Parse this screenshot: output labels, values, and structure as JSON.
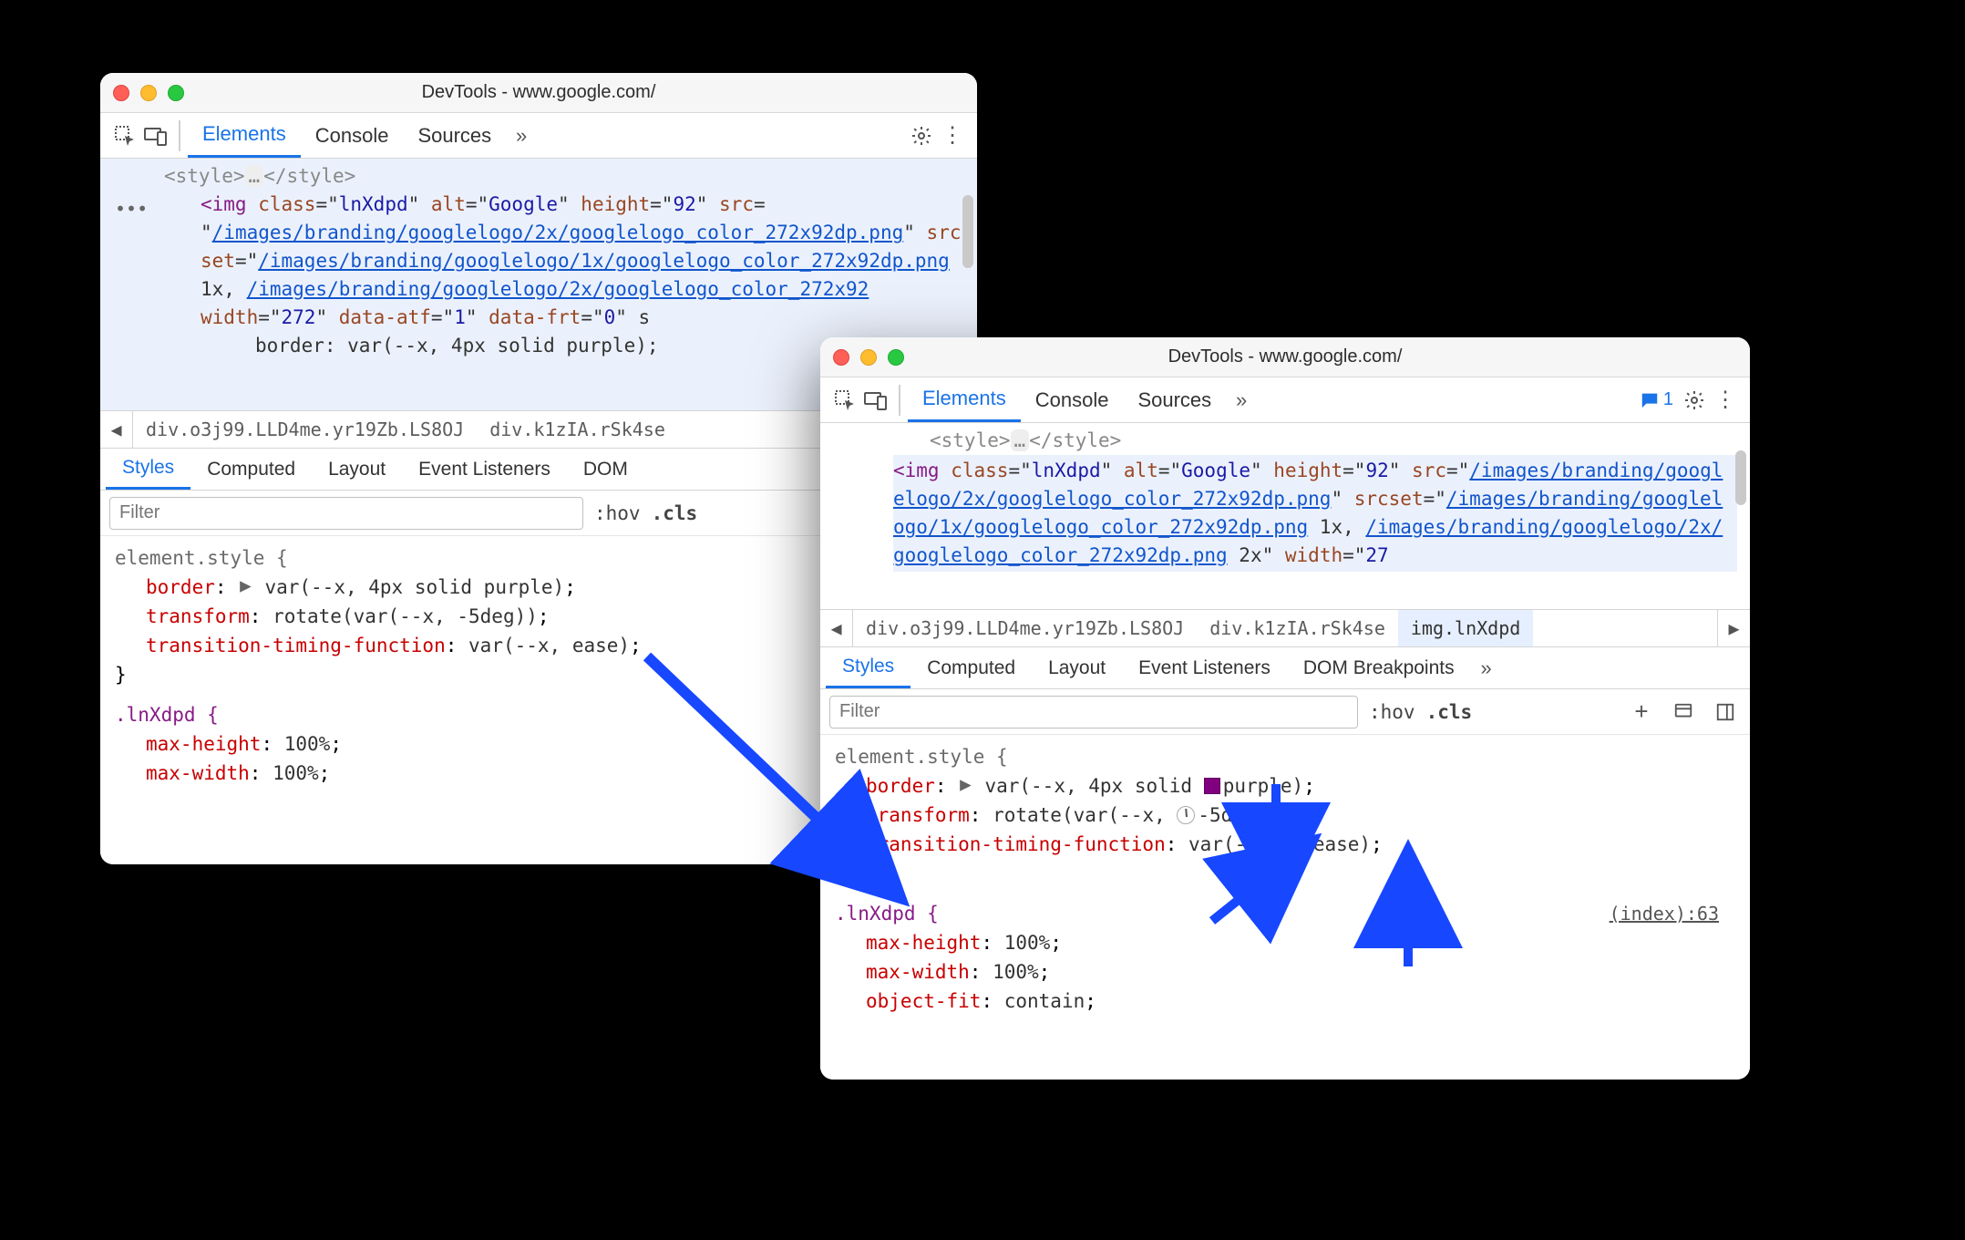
{
  "windows": {
    "left": {
      "title": "DevTools - www.google.com/",
      "tabs": {
        "elements": "Elements",
        "console": "Console",
        "sources": "Sources"
      },
      "dom": {
        "line0": "<style>…</style>",
        "img_open": "<img",
        "class_attr": "class",
        "class_val": "lnXdpd",
        "alt_attr": "alt",
        "alt_val": "Google",
        "height_attr": "height",
        "height_val": "92",
        "src_attr": "src",
        "src_val": "/images/branding/googlelogo/2x/googlelogo_color_272x92dp.png",
        "srcset_attr": "srcset",
        "srcset_val1": "/images/branding/googlelogo/1x/googlelogo_color_272x92dp.png",
        "srcset_1x": " 1x, ",
        "srcset_val2": "/images/branding/googlelogo/2x/googlelogo_color_272x92",
        "width_attr": "width",
        "width_val": "272",
        "data_atf_attr": "data-atf",
        "data_atf_val": "1",
        "data_frt_attr": "data-frt",
        "data_frt_val": "0",
        "inline_style_label": "border: var(--x, 4px solid purple);"
      },
      "crumbs": {
        "a": "div.o3j99.LLD4me.yr19Zb.LS8OJ",
        "b": "div.k1zIA.rSk4se"
      },
      "subtabs": {
        "styles": "Styles",
        "computed": "Computed",
        "layout": "Layout",
        "events": "Event Listeners",
        "dom": "DOM "
      },
      "filter": {
        "placeholder": "Filter",
        "hov": ":hov",
        "cls": ".cls"
      },
      "styles": {
        "selector0": "element.style {",
        "rule0a_prop": "border",
        "rule0a_val": "var(--x, 4px solid purple)",
        "rule0b_prop": "transform",
        "rule0b_val": "rotate(var(--x, -5deg))",
        "rule0c_prop": "transition-timing-function",
        "rule0c_val": "var(--x, ease)",
        "close0": "}",
        "selector1": ".lnXdpd {",
        "rule1a_prop": "max-height",
        "rule1a_val": "100%",
        "rule1b_prop": "max-width",
        "rule1b_val": "100%"
      }
    },
    "right": {
      "title": "DevTools - www.google.com/",
      "tabs": {
        "elements": "Elements",
        "console": "Console",
        "sources": "Sources"
      },
      "messages": "1",
      "dom": {
        "line0": "<style>…</style>",
        "img_open": "<img",
        "class_attr": "class",
        "class_val": "lnXdpd",
        "alt_attr": "alt",
        "alt_val": "Google",
        "height_attr": "height",
        "height_val": "92",
        "src_attr": "src",
        "src_val": "/images/branding/googlelogo/2x/googlelogo_color_272x92dp.png",
        "srcset_attr": "srcset",
        "srcset_val1": "/images/branding/googlelogo/1x/googlelogo_color_272x92dp.png",
        "srcset_1x": " 1x, ",
        "srcset_val2": "/images/branding/googlelogo/2x/googlelogo_color_272x92dp.png",
        "srcset_2x": " 2x",
        "width_attr": "width",
        "width_val": "27"
      },
      "crumbs": {
        "a": "div.o3j99.LLD4me.yr19Zb.LS8OJ",
        "b": "div.k1zIA.rSk4se",
        "c": "img.lnXdpd"
      },
      "subtabs": {
        "styles": "Styles",
        "computed": "Computed",
        "layout": "Layout",
        "events": "Event Listeners",
        "dom": "DOM Breakpoints"
      },
      "filter": {
        "placeholder": "Filter",
        "hov": ":hov",
        "cls": ".cls"
      },
      "styles": {
        "selector0": "element.style {",
        "rule0a_prop": "border",
        "rule0a_pre": "var(--x, 4px solid ",
        "rule0a_color": "purple",
        "rule0a_post": ")",
        "rule0b_prop": "transform",
        "rule0b_pre": "rotate(var(--x, ",
        "rule0b_deg": "-5deg",
        "rule0b_post": "))",
        "rule0c_prop": "transition-timing-function",
        "rule0c_pre": "var(--x, ",
        "rule0c_ease": "ease",
        "rule0c_post": ")",
        "close0": "}",
        "selector1": ".lnXdpd {",
        "src_file": "(index):63",
        "rule1a_prop": "max-height",
        "rule1a_val": "100%",
        "rule1b_prop": "max-width",
        "rule1b_val": "100%",
        "rule1c_prop": "object-fit",
        "rule1c_val": "contain"
      }
    }
  }
}
